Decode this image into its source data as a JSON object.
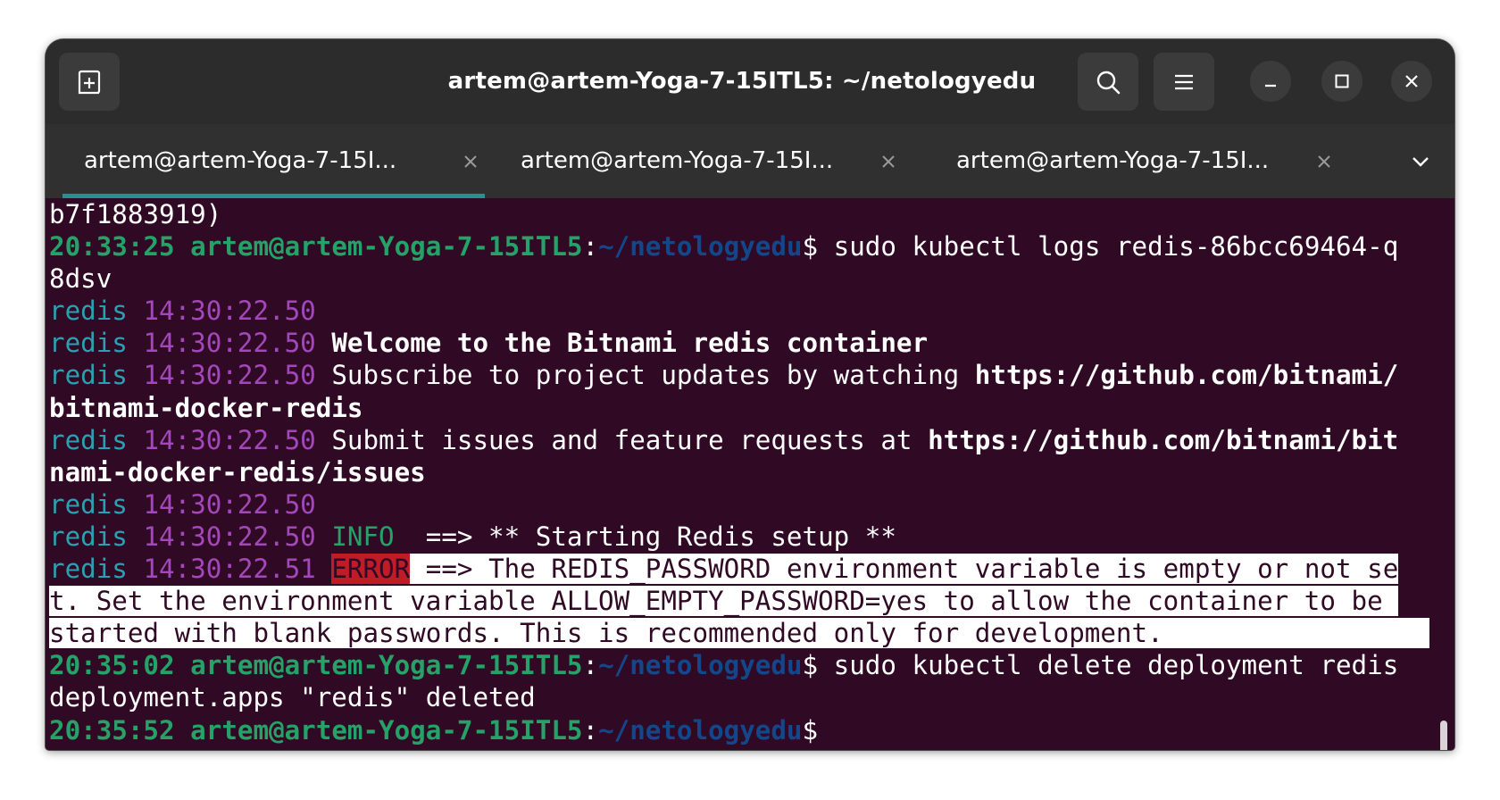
{
  "window": {
    "title": "artem@artem-Yoga-7-15ITL5: ~/netologyedu"
  },
  "header": {
    "new_tab_icon": "new-tab-icon",
    "search_icon": "search-icon",
    "menu_icon": "hamburger-menu-icon",
    "minimize_icon": "minimize-icon",
    "maximize_icon": "maximize-icon",
    "close_icon": "close-icon"
  },
  "tabs": [
    {
      "label": "artem@artem-Yoga-7-15I...",
      "active": true
    },
    {
      "label": "artem@artem-Yoga-7-15I...",
      "active": false
    },
    {
      "label": "artem@artem-Yoga-7-15I...",
      "active": false
    }
  ],
  "terminal": {
    "colors": {
      "background": "#300a24",
      "prompt_user": "#26a269",
      "prompt_path": "#12488b",
      "log_source": "#2aa1b3",
      "log_time": "#a347ba",
      "error_badge": "#c01c28"
    },
    "lines": {
      "l0": {
        "text": "b7f1883919)"
      },
      "l1": {
        "time": "20:33:25",
        "userhost": "artem@artem-Yoga-7-15ITL5",
        "colon": ":",
        "path": "~/netologyedu",
        "dollar": "$",
        "cmd": " sudo kubectl logs redis-86bcc69464-q"
      },
      "l2": {
        "text": "8dsv"
      },
      "l3": {
        "src": "redis",
        "time": "14:30:22.50"
      },
      "l4": {
        "src": "redis",
        "time": "14:30:22.50",
        "msg": "Welcome to the Bitnami redis container"
      },
      "l5": {
        "src": "redis",
        "time": "14:30:22.50",
        "msg": "Subscribe to project updates by watching ",
        "link": "https://github.com/bitnami/"
      },
      "l6": {
        "link": "bitnami-docker-redis"
      },
      "l7": {
        "src": "redis",
        "time": "14:30:22.50",
        "msg": "Submit issues and feature requests at ",
        "link": "https://github.com/bitnami/bit"
      },
      "l8": {
        "link": "nami-docker-redis/issues"
      },
      "l9": {
        "src": "redis",
        "time": "14:30:22.50"
      },
      "l10": {
        "src": "redis",
        "time": "14:30:22.50",
        "level": "INFO",
        "msg": "  ==> ** Starting Redis setup **"
      },
      "l11": {
        "src": "redis",
        "time": "14:30:22.51",
        "level": "ERROR",
        "msg": " ==> The REDIS_PASSWORD environment variable is empty or not se"
      },
      "l12": {
        "text": "t. Set the environment variable ALLOW_EMPTY_PASSWORD=yes to allow the container to be "
      },
      "l13": {
        "text": "started with blank passwords. This is recommended only for development."
      },
      "l14": {
        "time": "20:35:02",
        "userhost": "artem@artem-Yoga-7-15ITL5",
        "colon": ":",
        "path": "~/netologyedu",
        "dollar": "$",
        "cmd": " sudo kubectl delete deployment redis"
      },
      "l15": {
        "text": "deployment.apps \"redis\" deleted"
      },
      "l16": {
        "time": "20:35:52",
        "userhost": "artem@artem-Yoga-7-15ITL5",
        "colon": ":",
        "path": "~/netologyedu",
        "dollar": "$"
      }
    }
  }
}
